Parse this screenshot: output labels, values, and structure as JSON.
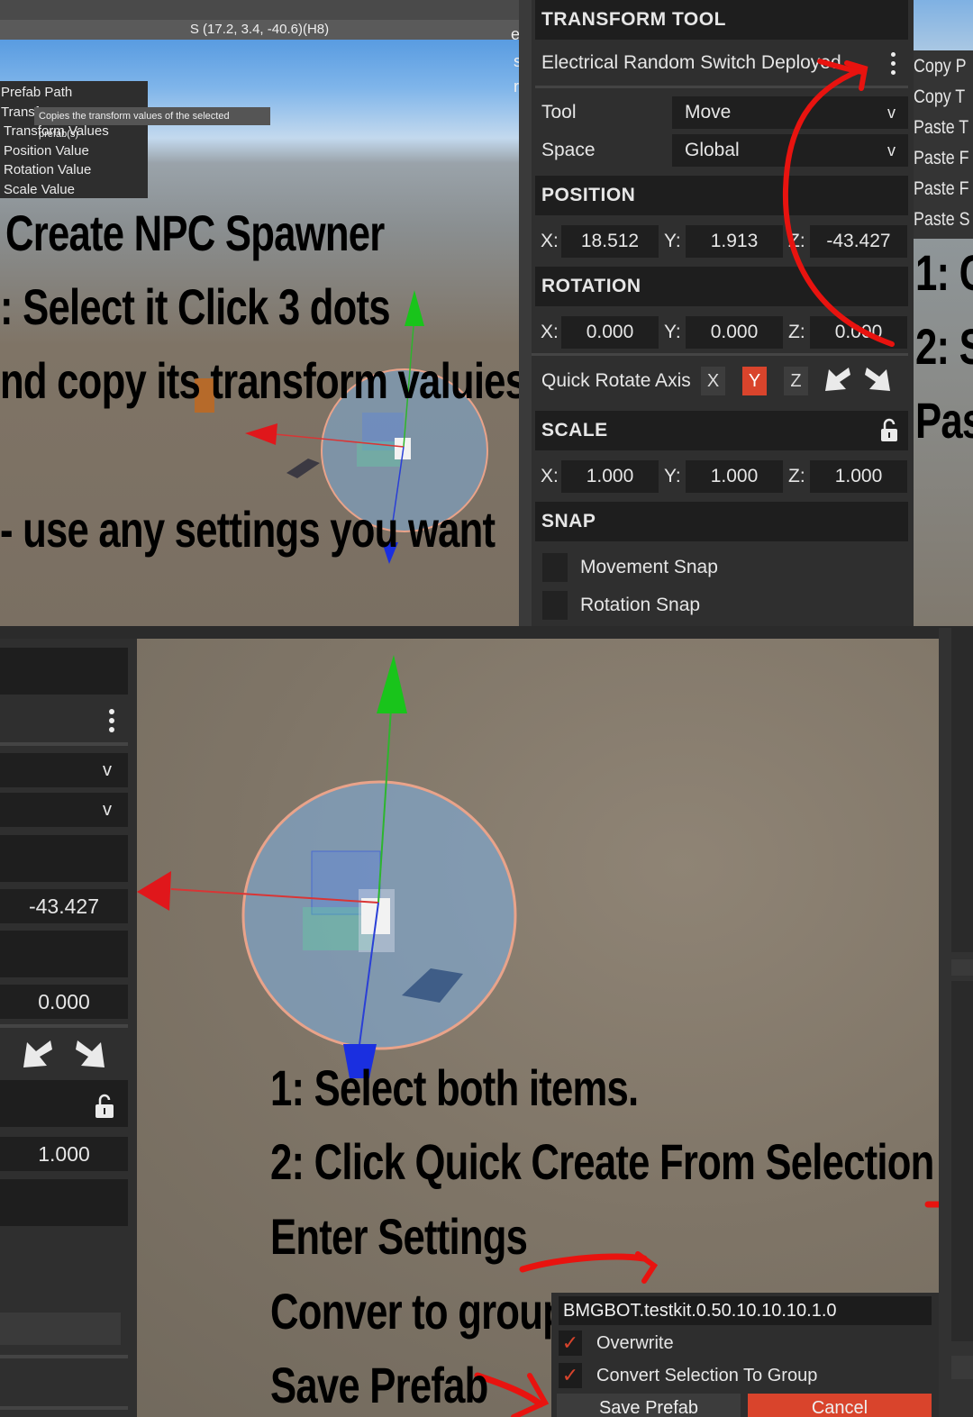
{
  "viewport_top": {
    "coords": "S (17.2, 3.4, -40.6)(H8)",
    "context_menu": {
      "items": [
        "Prefab Path",
        "Transf",
        "Transform Values",
        "Position Value",
        "Rotation Value",
        "Scale Value"
      ],
      "tooltip": "Copies the transform values of the selected prefab(s)"
    },
    "annotations": [
      "Create NPC Spawner",
      ": Select it Click 3 dots",
      "nd copy its transform valuies",
      "- use any settings you want"
    ],
    "edge_glyphs": [
      "ea.",
      "st",
      "rt"
    ]
  },
  "transform_panel": {
    "title": "TRANSFORM TOOL",
    "object_name": "Electrical Random Switch Deployed",
    "tool_label": "Tool",
    "tool_value": "Move",
    "space_label": "Space",
    "space_value": "Global",
    "position": {
      "header": "POSITION",
      "x": "18.512",
      "y": "1.913",
      "z": "-43.427"
    },
    "rotation": {
      "header": "ROTATION",
      "x": "0.000",
      "y": "0.000",
      "z": "0.000"
    },
    "quick_rotate": {
      "label": "Quick Rotate Axis",
      "axes": [
        "X",
        "Y",
        "Z"
      ],
      "active_axis": "Y"
    },
    "scale": {
      "header": "SCALE",
      "x": "1.000",
      "y": "1.000",
      "z": "1.000"
    },
    "snap": {
      "header": "SNAP",
      "movement": "Movement Snap",
      "rotation": "Rotation Snap"
    },
    "axis_labels": {
      "x": "X:",
      "y": "Y:",
      "z": "Z:"
    }
  },
  "right_menu": {
    "items": [
      "Copy P",
      "Copy T",
      "Paste T",
      "Paste F",
      "Paste F",
      "Paste S"
    ],
    "annotations": [
      "1: C",
      "2: S",
      "Pas"
    ]
  },
  "bottom_left_panel": {
    "position_z": "-43.427",
    "rotation_z": "0.000",
    "scale_z": "1.000"
  },
  "viewport_bottom": {
    "annotations": [
      "1: Select both items.",
      "2: Click Quick Create From Selection",
      "Enter Settings",
      "Conver to group",
      "Save Prefab"
    ]
  },
  "prefab_dialog": {
    "name_value": "BMGBOT.testkit.0.50.10.10.10.1.0",
    "overwrite_label": "Overwrite",
    "convert_label": "Convert Selection To Group",
    "save_label": "Save Prefab",
    "cancel_label": "Cancel"
  },
  "colors": {
    "panel_bg": "#2f2f2f",
    "header_bg": "#1e1e1e",
    "accent_red": "#d9442c",
    "annotation_red": "#e8130f",
    "gizmo_green": "#19c41b",
    "gizmo_red": "#e0171b",
    "gizmo_blue": "#1a2fe0"
  }
}
